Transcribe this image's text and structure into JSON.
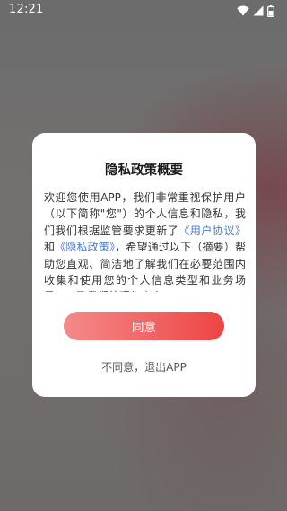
{
  "status_bar": {
    "time": "12:21",
    "icons": [
      "wifi-icon",
      "cellular-signal-icon",
      "battery-icon"
    ]
  },
  "dialog": {
    "title": "隐私政策概要",
    "body": {
      "segment1": "欢迎您使用APP，我们非常重视保护用户（以下简称\"您\"）的个人信息和隐私，我们我们根据监管要求更新了",
      "link_user_agreement": "《用户协议》",
      "segment2": "和",
      "link_privacy_policy": "《隐私政策》",
      "segment3": "，希望通过以下（摘要）帮助您直观、简洁地了解我们在必要范围内收集和使用您的个人信息类型和业务场景，以及我们处理您个人"
    },
    "agree_label": "同意",
    "exit_label": "不同意，退出APP"
  },
  "colors": {
    "button_gradient_start": "#f58a8a",
    "button_gradient_end": "#ee4444",
    "link": "#4a78c8"
  }
}
